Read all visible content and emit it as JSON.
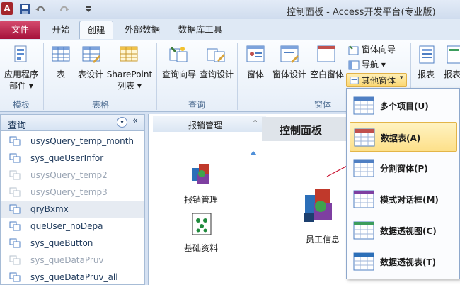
{
  "window": {
    "title": "控制面板 - Access开发平台(专业版)"
  },
  "tabs": {
    "file": "文件",
    "items": [
      "开始",
      "创建",
      "外部数据",
      "数据库工具"
    ]
  },
  "ribbon": {
    "app_parts": "应用程序",
    "app_parts2": "部件",
    "table": "表",
    "table_design": "表设计",
    "sharepoint": "SharePoint",
    "sharepoint2": "列表",
    "query_wizard": "查询向导",
    "query_design": "查询设计",
    "form": "窗体",
    "form_design": "窗体设计",
    "blank_form": "空白窗体",
    "form_wizard": "窗体向导",
    "navigation": "导航",
    "other_forms": "其他窗体",
    "report": "报表",
    "report2": "报表",
    "groups": {
      "templates": "模板",
      "tables": "表格",
      "queries": "查询",
      "forms": "窗体"
    }
  },
  "nav": {
    "header": "查询",
    "items": [
      {
        "label": "usysQuery_temp_month",
        "dim": false
      },
      {
        "label": "sys_queUserInfor",
        "dim": false
      },
      {
        "label": "usysQuery_temp2",
        "dim": true
      },
      {
        "label": "usysQuery_temp3",
        "dim": true
      },
      {
        "label": "qryBxmx",
        "dim": false
      },
      {
        "label": "queUser_noDepa",
        "dim": false
      },
      {
        "label": "sys_queButton",
        "dim": false
      },
      {
        "label": "sys_queDataPruv",
        "dim": true
      },
      {
        "label": "sys_queDataPruv_all",
        "dim": false
      }
    ]
  },
  "canvas": {
    "panel_title": "报销管理",
    "heading": "控制面板",
    "icons": [
      "报销管理",
      "基础资料",
      "员工信息"
    ]
  },
  "dropdown": {
    "items": [
      "多个项目(U)",
      "数据表(A)",
      "分割窗体(P)",
      "模式对话框(M)",
      "数据透视图(C)",
      "数据透视表(T)"
    ],
    "highlighted_index": 1
  },
  "colors": {
    "accent": "#a5103a",
    "highlight": "#fde08a",
    "arrow": "#c8102e"
  }
}
